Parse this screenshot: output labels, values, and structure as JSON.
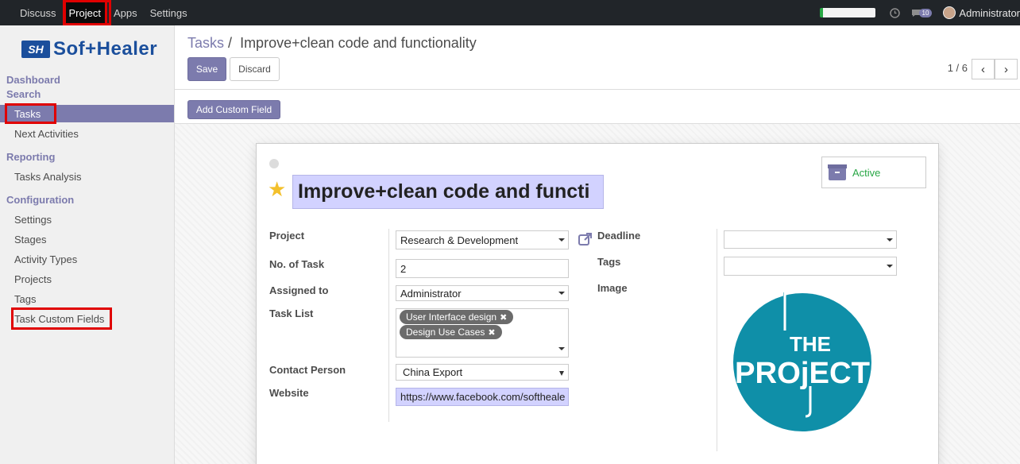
{
  "navbar": {
    "menu": [
      "Discuss",
      "Project",
      "Apps",
      "Settings"
    ],
    "active": "Project",
    "chat_count": "10",
    "user": "Administrator"
  },
  "sidebar": {
    "logo_mark": "SH",
    "logo_text": "Sof+Healer",
    "dashboard": "Dashboard",
    "search": "Search",
    "tasks": "Tasks",
    "next_activities": "Next Activities",
    "reporting": "Reporting",
    "tasks_analysis": "Tasks Analysis",
    "configuration": "Configuration",
    "settings": "Settings",
    "stages": "Stages",
    "activity_types": "Activity Types",
    "projects": "Projects",
    "tags": "Tags",
    "task_custom_fields": "Task Custom Fields"
  },
  "control": {
    "breadcrumb_parent": "Tasks",
    "breadcrumb_sep": "/",
    "breadcrumb_current": "Improve+clean code and functionality",
    "save": "Save",
    "discard": "Discard",
    "pager": "1 / 6",
    "add_custom_field": "Add Custom Field"
  },
  "form": {
    "title": "Improve+clean code and functi",
    "active_label": "Active",
    "labels": {
      "project": "Project",
      "no_of_task": "No. of Task",
      "assigned_to": "Assigned to",
      "task_list": "Task List",
      "contact_person": "Contact Person",
      "website": "Website",
      "deadline": "Deadline",
      "tags": "Tags",
      "image": "Image"
    },
    "values": {
      "project": "Research & Development",
      "no_of_task": "2",
      "assigned_to": "Administrator",
      "task_list_tags": [
        "User Interface design",
        "Design Use Cases"
      ],
      "contact_person": "China Export",
      "website": "https://www.facebook.com/softheale",
      "deadline": "",
      "tags": ""
    },
    "image_text_top": "THE",
    "image_text_main": "PROjECT"
  },
  "colors": {
    "brand": "#7c7bad",
    "navbar": "#212529",
    "highlight": "#e00000",
    "required": "#d2d2ff",
    "project_logo": "#0f8fa8"
  }
}
